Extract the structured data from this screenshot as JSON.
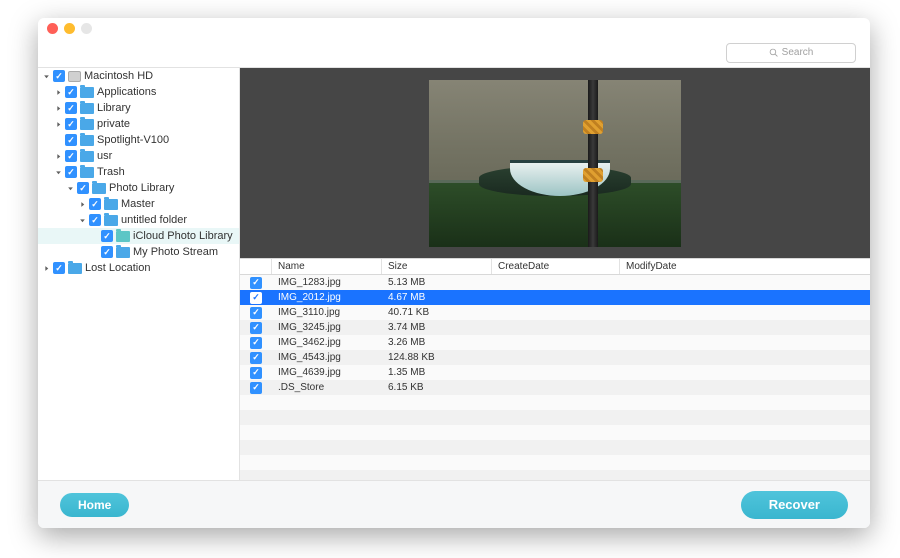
{
  "colors": {
    "close": "#ff5f57",
    "min": "#febc2e",
    "max": "#e6e6e6",
    "check": "#3091ff",
    "folder_blue": "#4aa8e8",
    "folder_teal": "#5cc6c6",
    "accent": "#3ab6cf",
    "row_selected": "#1a73ff"
  },
  "search": {
    "placeholder": "Search"
  },
  "sidebar": [
    {
      "depth": 0,
      "arrow": "down",
      "checked": true,
      "icon": "disk",
      "label": "Macintosh HD"
    },
    {
      "depth": 1,
      "arrow": "right",
      "checked": true,
      "icon": "folder",
      "color": "blue",
      "label": "Applications"
    },
    {
      "depth": 1,
      "arrow": "right",
      "checked": true,
      "icon": "folder",
      "color": "blue",
      "label": "Library"
    },
    {
      "depth": 1,
      "arrow": "right",
      "checked": true,
      "icon": "folder",
      "color": "blue",
      "label": "private"
    },
    {
      "depth": 1,
      "arrow": "",
      "checked": true,
      "icon": "folder",
      "color": "blue",
      "label": "Spotlight-V100"
    },
    {
      "depth": 1,
      "arrow": "right",
      "checked": true,
      "icon": "folder",
      "color": "blue",
      "label": "usr"
    },
    {
      "depth": 1,
      "arrow": "down",
      "checked": true,
      "icon": "folder",
      "color": "blue",
      "label": "Trash"
    },
    {
      "depth": 2,
      "arrow": "down",
      "checked": true,
      "icon": "folder",
      "color": "blue",
      "label": "Photo Library"
    },
    {
      "depth": 3,
      "arrow": "right",
      "checked": true,
      "icon": "folder",
      "color": "blue",
      "label": "Master"
    },
    {
      "depth": 3,
      "arrow": "down",
      "checked": true,
      "icon": "folder",
      "color": "blue",
      "label": "untitled folder"
    },
    {
      "depth": 4,
      "arrow": "",
      "checked": true,
      "icon": "folder",
      "color": "teal",
      "label": "iCloud Photo Library",
      "selected": true
    },
    {
      "depth": 4,
      "arrow": "",
      "checked": true,
      "icon": "folder",
      "color": "blue",
      "label": "My Photo Stream"
    },
    {
      "depth": 0,
      "arrow": "right",
      "checked": true,
      "icon": "folder",
      "color": "blue",
      "label": "Lost Location"
    }
  ],
  "table": {
    "headers": {
      "name": "Name",
      "size": "Size",
      "create": "CreateDate",
      "modify": "ModifyDate"
    },
    "rows": [
      {
        "checked": true,
        "name": "IMG_1283.jpg",
        "size": "5.13 MB",
        "selected": false
      },
      {
        "checked": true,
        "name": "IMG_2012.jpg",
        "size": "4.67 MB",
        "selected": true
      },
      {
        "checked": true,
        "name": "IMG_3110.jpg",
        "size": "40.71 KB",
        "selected": false
      },
      {
        "checked": true,
        "name": "IMG_3245.jpg",
        "size": "3.74 MB",
        "selected": false
      },
      {
        "checked": true,
        "name": "IMG_3462.jpg",
        "size": "3.26 MB",
        "selected": false
      },
      {
        "checked": true,
        "name": "IMG_4543.jpg",
        "size": "124.88 KB",
        "selected": false
      },
      {
        "checked": true,
        "name": "IMG_4639.jpg",
        "size": "1.35 MB",
        "selected": false
      },
      {
        "checked": true,
        "name": ".DS_Store",
        "size": "6.15 KB",
        "selected": false
      }
    ]
  },
  "buttons": {
    "home": "Home",
    "recover": "Recover"
  }
}
